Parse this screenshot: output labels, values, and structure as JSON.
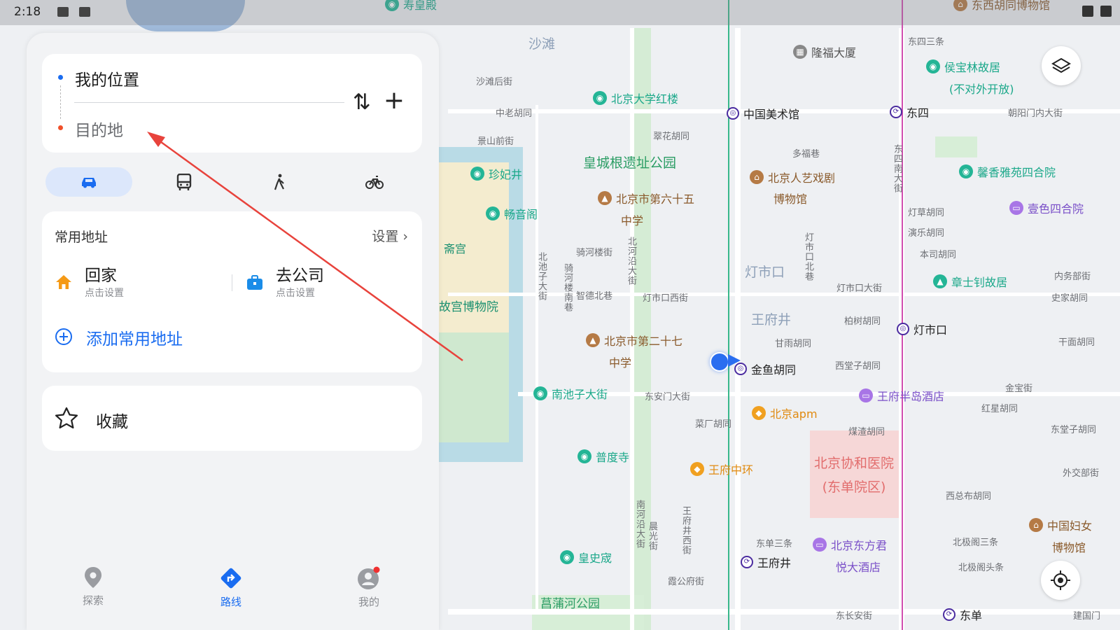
{
  "status": {
    "time": "2:18"
  },
  "route": {
    "origin": "我的位置",
    "destination_placeholder": "目的地"
  },
  "modes": [
    {
      "id": "drive",
      "active": true
    },
    {
      "id": "transit",
      "active": false
    },
    {
      "id": "walk",
      "active": false
    },
    {
      "id": "bike",
      "active": false
    }
  ],
  "favorites": {
    "title": "常用地址",
    "setting": "设置",
    "home": {
      "label": "回家",
      "sub": "点击设置"
    },
    "work": {
      "label": "去公司",
      "sub": "点击设置"
    },
    "add": "添加常用地址"
  },
  "collect": {
    "label": "收藏"
  },
  "tabs": [
    {
      "label": "探索",
      "active": false
    },
    {
      "label": "路线",
      "active": true
    },
    {
      "label": "我的",
      "active": false
    }
  ],
  "map": {
    "pois": [
      {
        "name": "寿皇殿",
        "style": "green"
      },
      {
        "name": "隆福大厦",
        "style": "gray"
      },
      {
        "name": "东西胡同博物馆",
        "style": "brown"
      },
      {
        "name": "北京大学红楼",
        "style": "green"
      },
      {
        "name": "侯宝林故居",
        "style": "green"
      },
      {
        "name": "(不对外开放)",
        "style": "green"
      },
      {
        "name": "中国美术馆",
        "style": "metro"
      },
      {
        "name": "东四",
        "style": "metro"
      },
      {
        "name": "珍妃井",
        "style": "green"
      },
      {
        "name": "北京人艺戏剧",
        "style": "brown"
      },
      {
        "name": "博物馆",
        "style": "brown"
      },
      {
        "name": "馨香雅苑四合院",
        "style": "green"
      },
      {
        "name": "北京市第六十五",
        "style": "brown"
      },
      {
        "name": "中学",
        "style": "brown"
      },
      {
        "name": "畅音阁",
        "style": "green"
      },
      {
        "name": "壹色四合院",
        "style": "purple"
      },
      {
        "name": "章士钊故居",
        "style": "green"
      },
      {
        "name": "灯市口",
        "style": "metro"
      },
      {
        "name": "北京市第二十七",
        "style": "brown"
      },
      {
        "name": "中学",
        "style": "brown"
      },
      {
        "name": "金鱼胡同",
        "style": "metro"
      },
      {
        "name": "南池子大街",
        "style": "green"
      },
      {
        "name": "王府半岛酒店",
        "style": "purple"
      },
      {
        "name": "北京apm",
        "style": "orange"
      },
      {
        "name": "普度寺",
        "style": "green"
      },
      {
        "name": "王府中环",
        "style": "orange"
      },
      {
        "name": "中国妇女",
        "style": "brown"
      },
      {
        "name": "博物馆",
        "style": "brown"
      },
      {
        "name": "北京东方君",
        "style": "purple"
      },
      {
        "name": "悦大酒店",
        "style": "purple"
      },
      {
        "name": "皇史宬",
        "style": "green"
      },
      {
        "name": "王府井",
        "style": "metro"
      },
      {
        "name": "东单",
        "style": "metro"
      }
    ],
    "areas": [
      "沙滩",
      "皇城根遗址公园",
      "灯市口",
      "王府井",
      "斋宫",
      "故宫博物院",
      "菖蒲河公园",
      "北京协和医院",
      "(东单院区)"
    ],
    "streets": [
      "东四三条",
      "沙滩后街",
      "中老胡同",
      "景山前街",
      "翠花胡同",
      "多福巷",
      "骑河楼街",
      "智德北巷",
      "灯市口西街",
      "灯市口大街",
      "柏树胡同",
      "甘雨胡同",
      "西堂子胡同",
      "东安门大街",
      "菜厂胡同",
      "煤渣胡同",
      "金宝街",
      "红星胡同",
      "东堂子胡同",
      "外交部街",
      "西总布胡同",
      "东单三条",
      "北极阁三条",
      "北极阁头条",
      "霞公府街",
      "灯草胡同",
      "演乐胡同",
      "本司胡同",
      "内务部街",
      "史家胡同",
      "干面胡同",
      "朝阳门内大街",
      "东长安街",
      "建国门"
    ],
    "vstreets": [
      "北池子大街",
      "骑河楼南巷",
      "北河沿大街",
      "灯市口北巷",
      "南河沿大街",
      "晨光街",
      "王府井西街",
      "东四南大街"
    ]
  }
}
